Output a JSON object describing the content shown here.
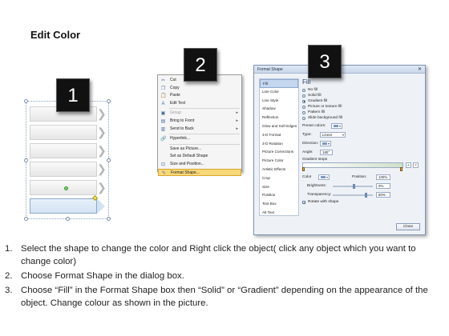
{
  "page": {
    "title": "Edit Color"
  },
  "badges": [
    "1",
    "2",
    "3"
  ],
  "context_menu": {
    "items": [
      {
        "label": "Cut",
        "icon": "scissors-icon",
        "glyph": "✂",
        "disabled": false
      },
      {
        "label": "Copy",
        "icon": "copy-icon",
        "glyph": "❐",
        "disabled": false
      },
      {
        "label": "Paste",
        "icon": "paste-icon",
        "glyph": "📋",
        "disabled": false
      },
      {
        "label": "Edit Text",
        "icon": "edit-text-icon",
        "glyph": "A",
        "disabled": false
      },
      {
        "label": "Group",
        "icon": "group-icon",
        "glyph": "▣",
        "disabled": true,
        "submenu": true
      },
      {
        "label": "Bring to Front",
        "icon": "bring-to-front-icon",
        "glyph": "▤",
        "disabled": false,
        "submenu": true
      },
      {
        "label": "Send to Back",
        "icon": "send-to-back-icon",
        "glyph": "▥",
        "disabled": false,
        "submenu": true
      },
      {
        "label": "Hyperlink...",
        "icon": "hyperlink-icon",
        "glyph": "🔗",
        "disabled": false
      },
      {
        "label": "Save as Picture...",
        "icon": "",
        "glyph": "",
        "disabled": false
      },
      {
        "label": "Set as Default Shape",
        "icon": "",
        "glyph": "",
        "disabled": false
      },
      {
        "label": "Size and Position...",
        "icon": "size-position-icon",
        "glyph": "⊡",
        "disabled": false
      },
      {
        "label": "Format Shape...",
        "icon": "format-shape-icon",
        "glyph": "✎",
        "disabled": false,
        "highlight": true
      }
    ]
  },
  "dialog": {
    "title": "Format Shape",
    "nav": [
      "Fill",
      "Line Color",
      "Line Style",
      "Shadow",
      "Reflection",
      "Glow and Soft Edges",
      "3-D Format",
      "3-D Rotation",
      "Picture Corrections",
      "Picture Color",
      "Artistic Effects",
      "Crop",
      "Size",
      "Position",
      "Text Box",
      "Alt Text"
    ],
    "active_nav": "Fill",
    "fill_heading": "Fill",
    "fill_options": [
      {
        "label": "No fill",
        "selected": false
      },
      {
        "label": "Solid fill",
        "selected": false
      },
      {
        "label": "Gradient fill",
        "selected": true
      },
      {
        "label": "Picture or texture fill",
        "selected": false
      },
      {
        "label": "Pattern fill",
        "selected": false
      },
      {
        "label": "Slide background fill",
        "selected": false
      }
    ],
    "preset_colors_label": "Preset colors:",
    "type_label": "Type:",
    "type_value": "Linear",
    "direction_label": "Direction:",
    "angle_label": "Angle:",
    "angle_value": "180°",
    "gradient_stops_label": "Gradient stops",
    "color_label": "Color",
    "position_label": "Position:",
    "position_value": "100%",
    "brightness_label": "Brightness:",
    "brightness_value": "0%",
    "transparency_label": "Transparency:",
    "transparency_value": "80%",
    "rotate_label": "Rotate with shape",
    "close_label": "Close"
  },
  "instructions": [
    {
      "num": "1.",
      "text": "Select the shape to change the color and Right click the object( click any object which you want to change color)"
    },
    {
      "num": "2.",
      "text": "Choose Format Shape in the dialog box."
    },
    {
      "num": "3.",
      "text": "Choose “Fill” in the Format Shape box then “Solid” or “Gradient” depending on the appearance of the object. Change colour as shown in the picture."
    }
  ]
}
